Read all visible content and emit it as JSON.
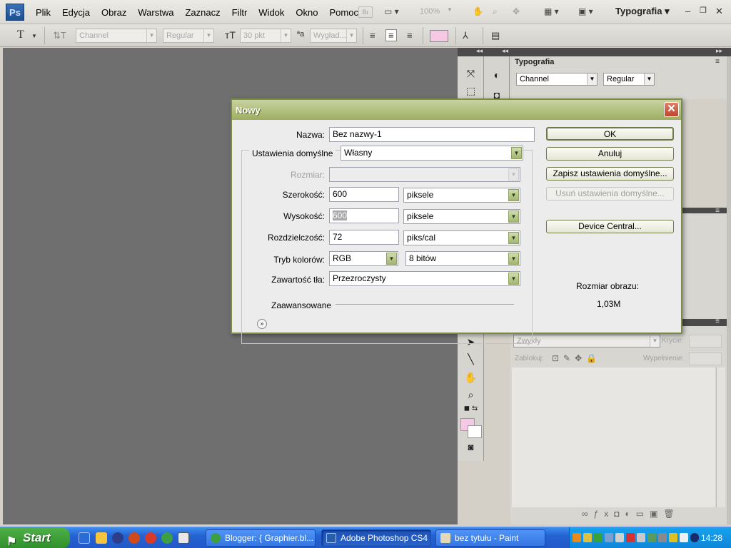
{
  "app": {
    "logo_text": "Ps",
    "menu": [
      "Plik",
      "Edycja",
      "Obraz",
      "Warstwa",
      "Zaznacz",
      "Filtr",
      "Widok",
      "Okno",
      "Pomoc"
    ],
    "bridge_label": "Br",
    "zoom": "100%",
    "workspace": "Typografia",
    "window_controls": {
      "minimize": "–",
      "restore": "❐",
      "close": "✕"
    }
  },
  "options_bar": {
    "font_family": "Channel",
    "font_style": "Regular",
    "font_size": "30 pkt",
    "antialias": "Wygład...",
    "tool_glyph": "T"
  },
  "typography_panel": {
    "title": "Typografia",
    "font_family": "Channel",
    "font_style": "Regular"
  },
  "layers_panel": {
    "blend_mode": "Zwykły",
    "opacity_label": "Krycie:",
    "lock_label": "Zablokuj:",
    "fill_label": "Wypełnienie:"
  },
  "dialog": {
    "title": "Nowy",
    "name_label": "Nazwa:",
    "name_value": "Bez nazwy-1",
    "preset_label": "Ustawienia domyślne",
    "preset_value": "Własny",
    "size_label": "Rozmiar:",
    "size_value": "",
    "width_label": "Szerokość:",
    "width_value": "600",
    "width_unit": "piksele",
    "height_label": "Wysokość:",
    "height_value": "600",
    "height_unit": "piksele",
    "resolution_label": "Rozdzielczość:",
    "resolution_value": "72",
    "resolution_unit": "piks/cal",
    "color_mode_label": "Tryb kolorów:",
    "color_mode_value": "RGB",
    "bit_depth_value": "8 bitów",
    "background_label": "Zawartość tła:",
    "background_value": "Przezroczysty",
    "advanced_label": "Zaawansowane",
    "buttons": {
      "ok": "OK",
      "cancel": "Anuluj",
      "save_preset": "Zapisz ustawienia domyślne...",
      "delete_preset": "Usuń ustawienia domyślne...",
      "device_central": "Device Central..."
    },
    "image_size_label": "Rozmiar obrazu:",
    "image_size_value": "1,03M"
  },
  "taskbar": {
    "start_label": "Start",
    "tasks": [
      {
        "label": "Blogger: { Graphier.bl...",
        "active": false
      },
      {
        "label": "Adobe Photoshop CS4",
        "active": true
      },
      {
        "label": "bez tytułu - Paint",
        "active": false
      }
    ],
    "clock": "14:28"
  },
  "colors": {
    "foreground": "#f6c8e4",
    "background": "#ffffff",
    "dialog_title": "#9caf60",
    "canvas": "#6f6f6f"
  }
}
